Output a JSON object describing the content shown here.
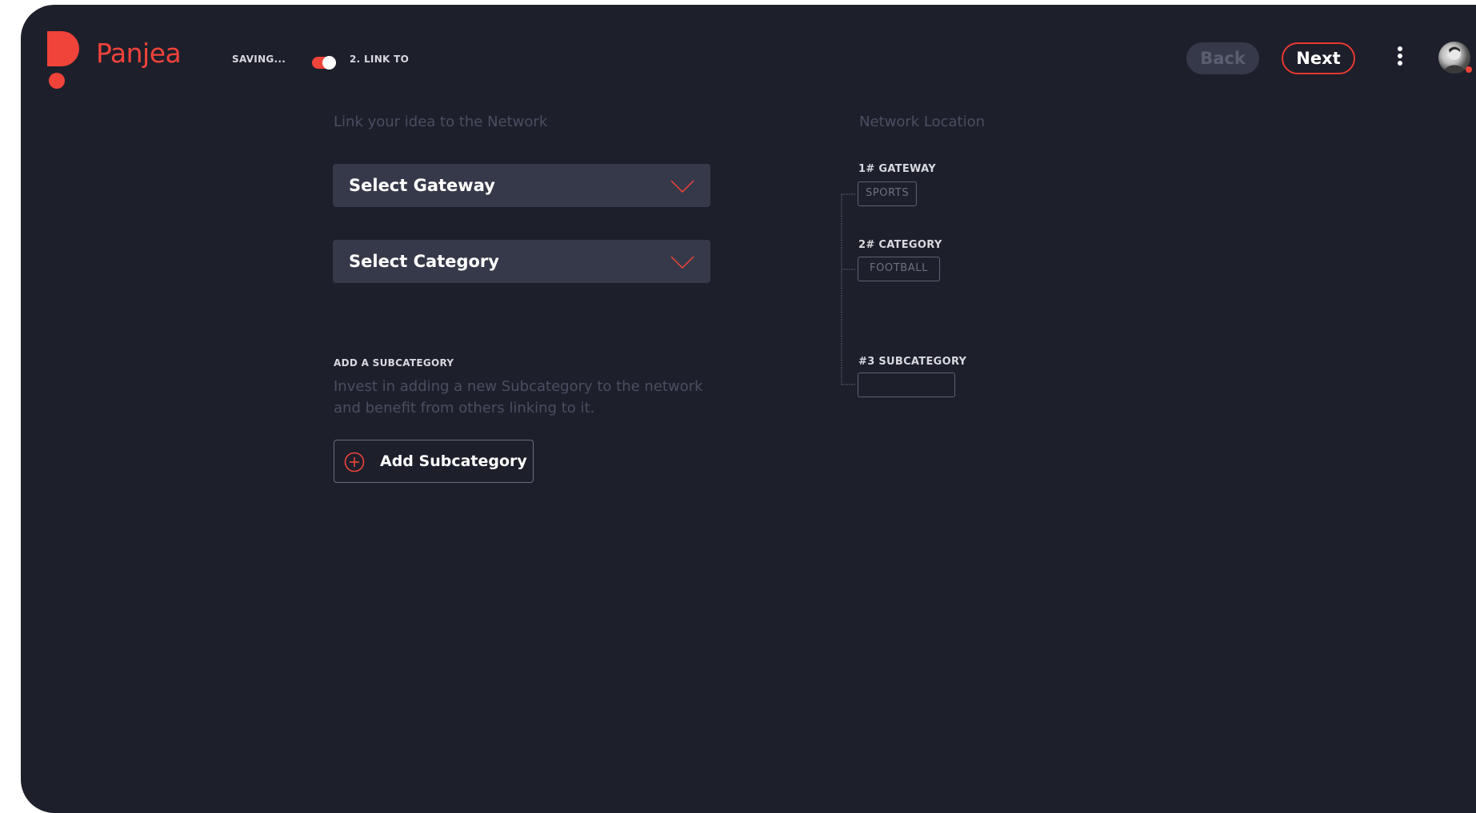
{
  "app": {
    "brand": "Panjea",
    "brand_color": "#f0433a",
    "background": "#1d1f2b"
  },
  "header": {
    "status_text": "SAVING...",
    "toggle_on": true,
    "step_label": "2. LINK TO",
    "back_label": "Back",
    "next_label": "Next",
    "menu_icon": "kebab-vertical-icon",
    "avatar_icon": "user-avatar"
  },
  "link": {
    "title": "Link your idea to the Network",
    "gateway_select": {
      "label": "Select Gateway",
      "icon": "chevron-down-icon"
    },
    "category_select": {
      "label": "Select Category",
      "icon": "chevron-down-icon"
    }
  },
  "subcategory": {
    "heading": "ADD A SUBCATEGORY",
    "description": "Invest in adding a new Subcategory to the network and benefit from others linking to it.",
    "button_label": "Add Subcategory",
    "button_icon": "plus-circle-icon"
  },
  "network": {
    "title": "Network Location",
    "levels": [
      {
        "label": "1# GATEWAY",
        "value": "SPORTS"
      },
      {
        "label": "2# CATEGORY",
        "value": "FOOTBALL"
      },
      {
        "label": "#3 SUBCATEGORY",
        "value": ""
      }
    ]
  }
}
